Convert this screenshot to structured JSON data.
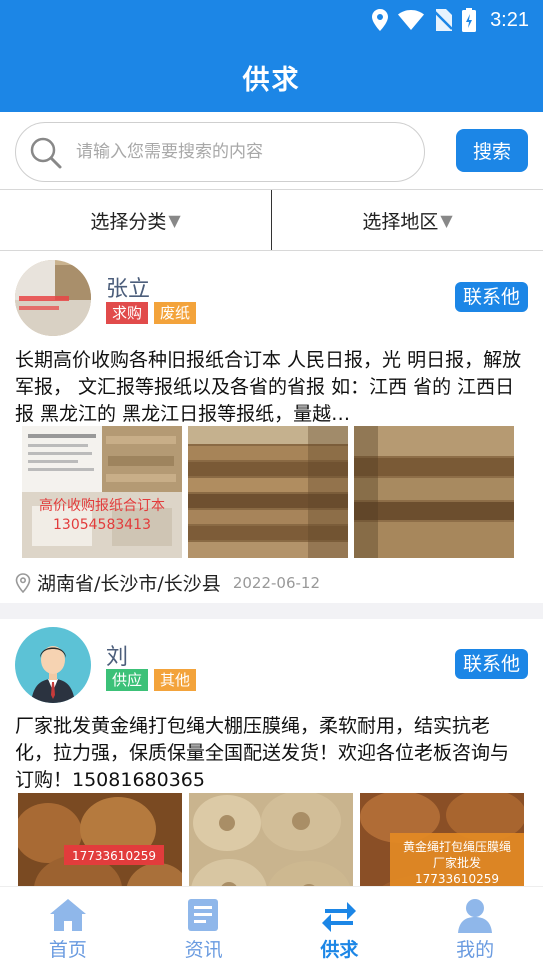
{
  "status_bar": {
    "time": "3:21"
  },
  "header": {
    "title": "供求"
  },
  "search": {
    "placeholder": "请输入您需要搜索的内容",
    "button_label": "搜索"
  },
  "filters": {
    "category_label": "选择分类",
    "region_label": "选择地区",
    "arrow": "▼"
  },
  "posts": [
    {
      "name": "张立",
      "tags": [
        {
          "text": "求购",
          "color": "#e14b4b"
        },
        {
          "text": "废纸",
          "color": "#f3a33b"
        }
      ],
      "contact_label": "联系他",
      "description": "长期高价收购各种旧报纸合订本 人民日报，光 明日报，解放军报， 文汇报等报纸以及各省的省报 如：江西 省的 江西日报 黑龙江的 黑龙江日报等报纸，量越…",
      "photo_captions": [
        "高价收购报纸合订本",
        "13054583413"
      ],
      "location": "湖南省/长沙市/长沙县",
      "date": "2022-06-12"
    },
    {
      "name": "刘",
      "tags": [
        {
          "text": "供应",
          "color": "#3cc178"
        },
        {
          "text": "其他",
          "color": "#f3a33b"
        }
      ],
      "contact_label": "联系他",
      "description": "厂家批发黄金绳打包绳大棚压膜绳，柔软耐用，结实抗老化，拉力强，保质保量全国配送发货！欢迎各位老板咨询与订购！15081680365",
      "photo_captions": [
        "17733610259",
        "黄金绳打包绳压膜绳",
        "厂家批发",
        "17733610259"
      ]
    }
  ],
  "bottom_nav": [
    {
      "label": "首页",
      "icon": "home-icon",
      "active": false
    },
    {
      "label": "资讯",
      "icon": "news-icon",
      "active": false
    },
    {
      "label": "供求",
      "icon": "exchange-icon",
      "active": true
    },
    {
      "label": "我的",
      "icon": "user-icon",
      "active": false
    }
  ],
  "colors": {
    "primary": "#1c86e6",
    "nav_inactive": "#6a9be0"
  }
}
